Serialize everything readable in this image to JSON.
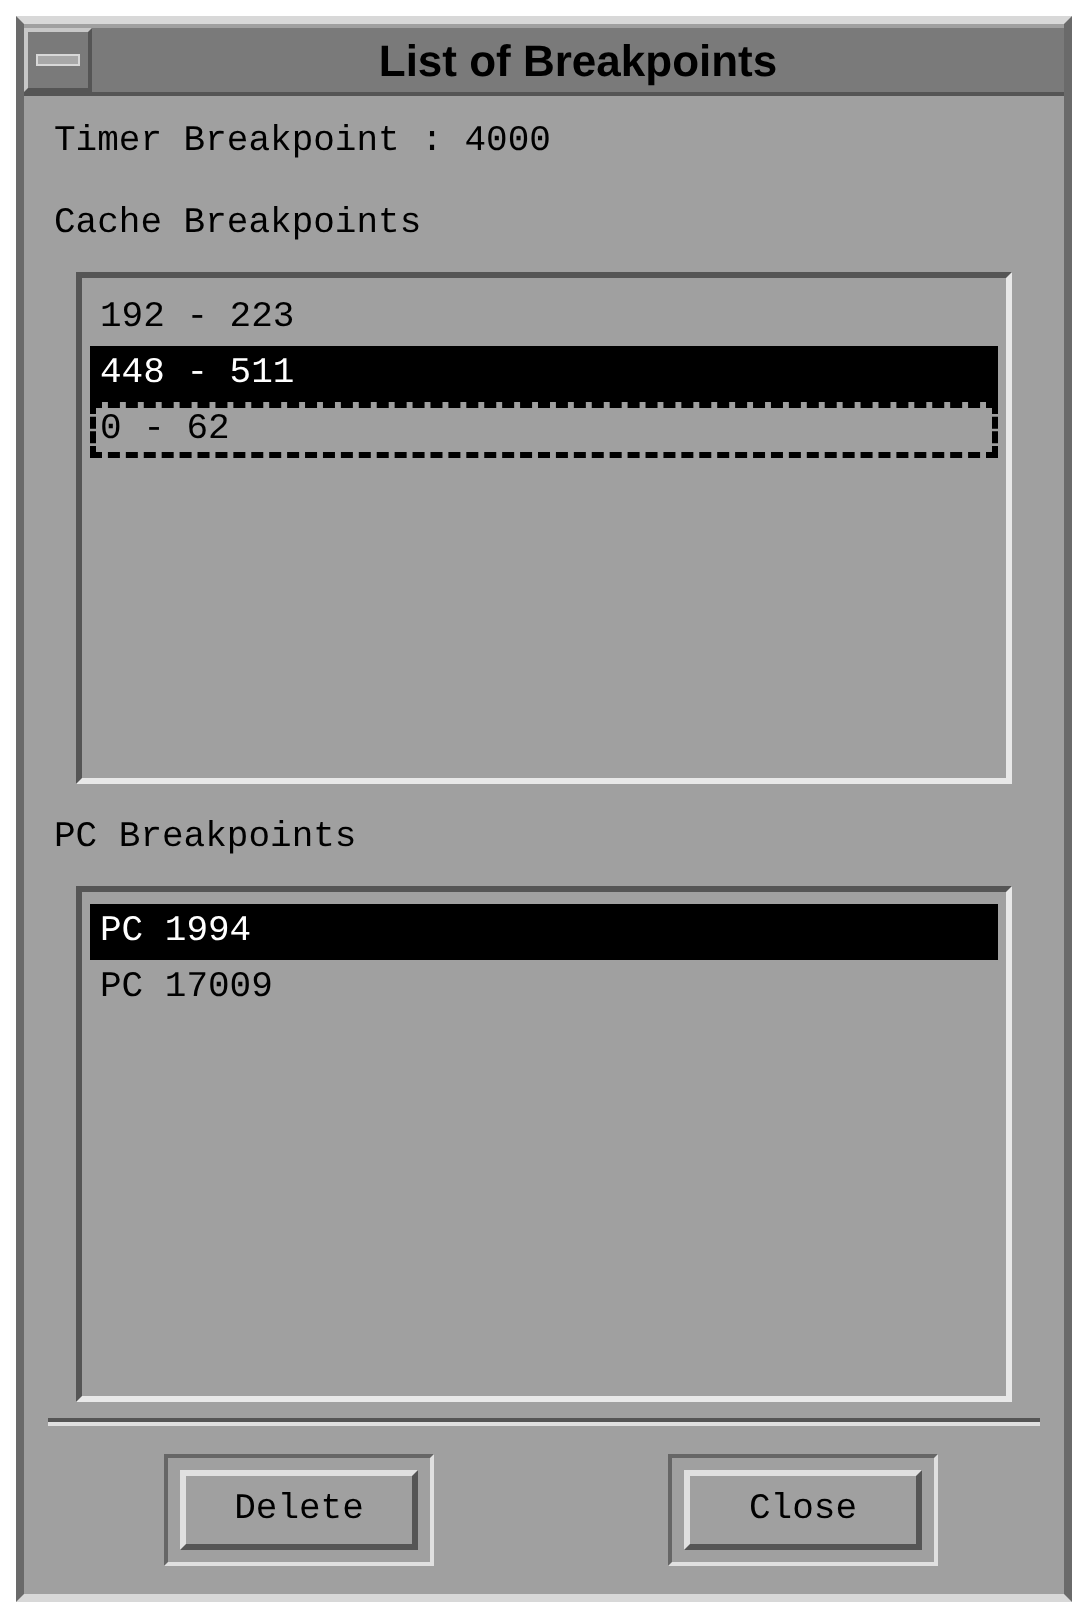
{
  "window": {
    "title": "List of Breakpoints"
  },
  "timer_breakpoint": "Timer Breakpoint : 4000",
  "cache_breakpoints": {
    "label": "Cache Breakpoints",
    "items": [
      {
        "text": "192 - 223",
        "selected": false,
        "focused": false
      },
      {
        "text": "448 - 511",
        "selected": true,
        "focused": false
      },
      {
        "text": "0 - 62",
        "selected": false,
        "focused": true
      }
    ]
  },
  "pc_breakpoints": {
    "label": "PC Breakpoints",
    "items": [
      {
        "text": "PC 1994",
        "selected": true,
        "focused": false
      },
      {
        "text": "PC 17009",
        "selected": false,
        "focused": false
      }
    ]
  },
  "buttons": [
    "Delete",
    "Close"
  ]
}
